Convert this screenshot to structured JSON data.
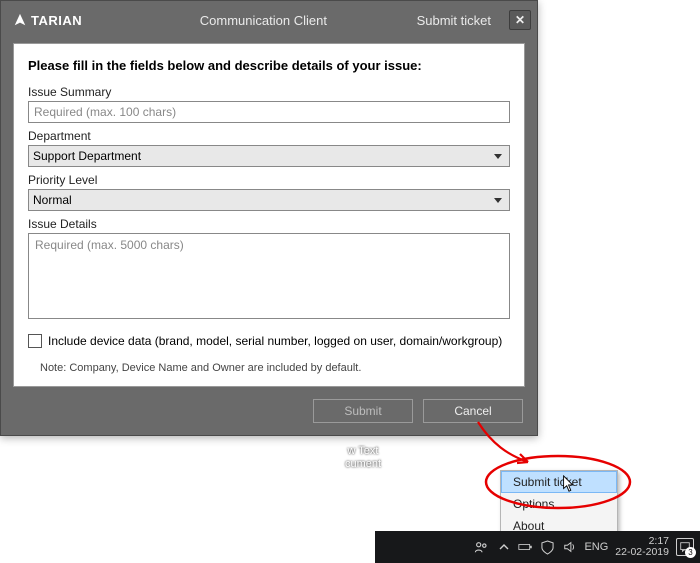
{
  "brand": "TARIAN",
  "window": {
    "app_title": "Communication Client",
    "section": "Submit ticket"
  },
  "form": {
    "instruction": "Please fill in the fields below and describe details of your issue:",
    "summary_label": "Issue Summary",
    "summary_placeholder": "Required (max. 100 chars)",
    "department_label": "Department",
    "department_value": "Support Department",
    "priority_label": "Priority Level",
    "priority_value": "Normal",
    "details_label": "Issue Details",
    "details_placeholder": "Required (max. 5000 chars)",
    "include_device_label": "Include device data (brand, model, serial number, logged on user, domain/workgroup)",
    "note": "Note: Company, Device Name and Owner are included by default."
  },
  "actions": {
    "submit": "Submit",
    "cancel": "Cancel"
  },
  "desktop_file": {
    "line1": "w Text",
    "line2": "cument"
  },
  "context_menu": {
    "items": [
      "Submit ticket",
      "Options",
      "About"
    ]
  },
  "taskbar": {
    "lang": "ENG",
    "time": "2:17",
    "date": "22-02-2019",
    "notif_count": "3"
  }
}
